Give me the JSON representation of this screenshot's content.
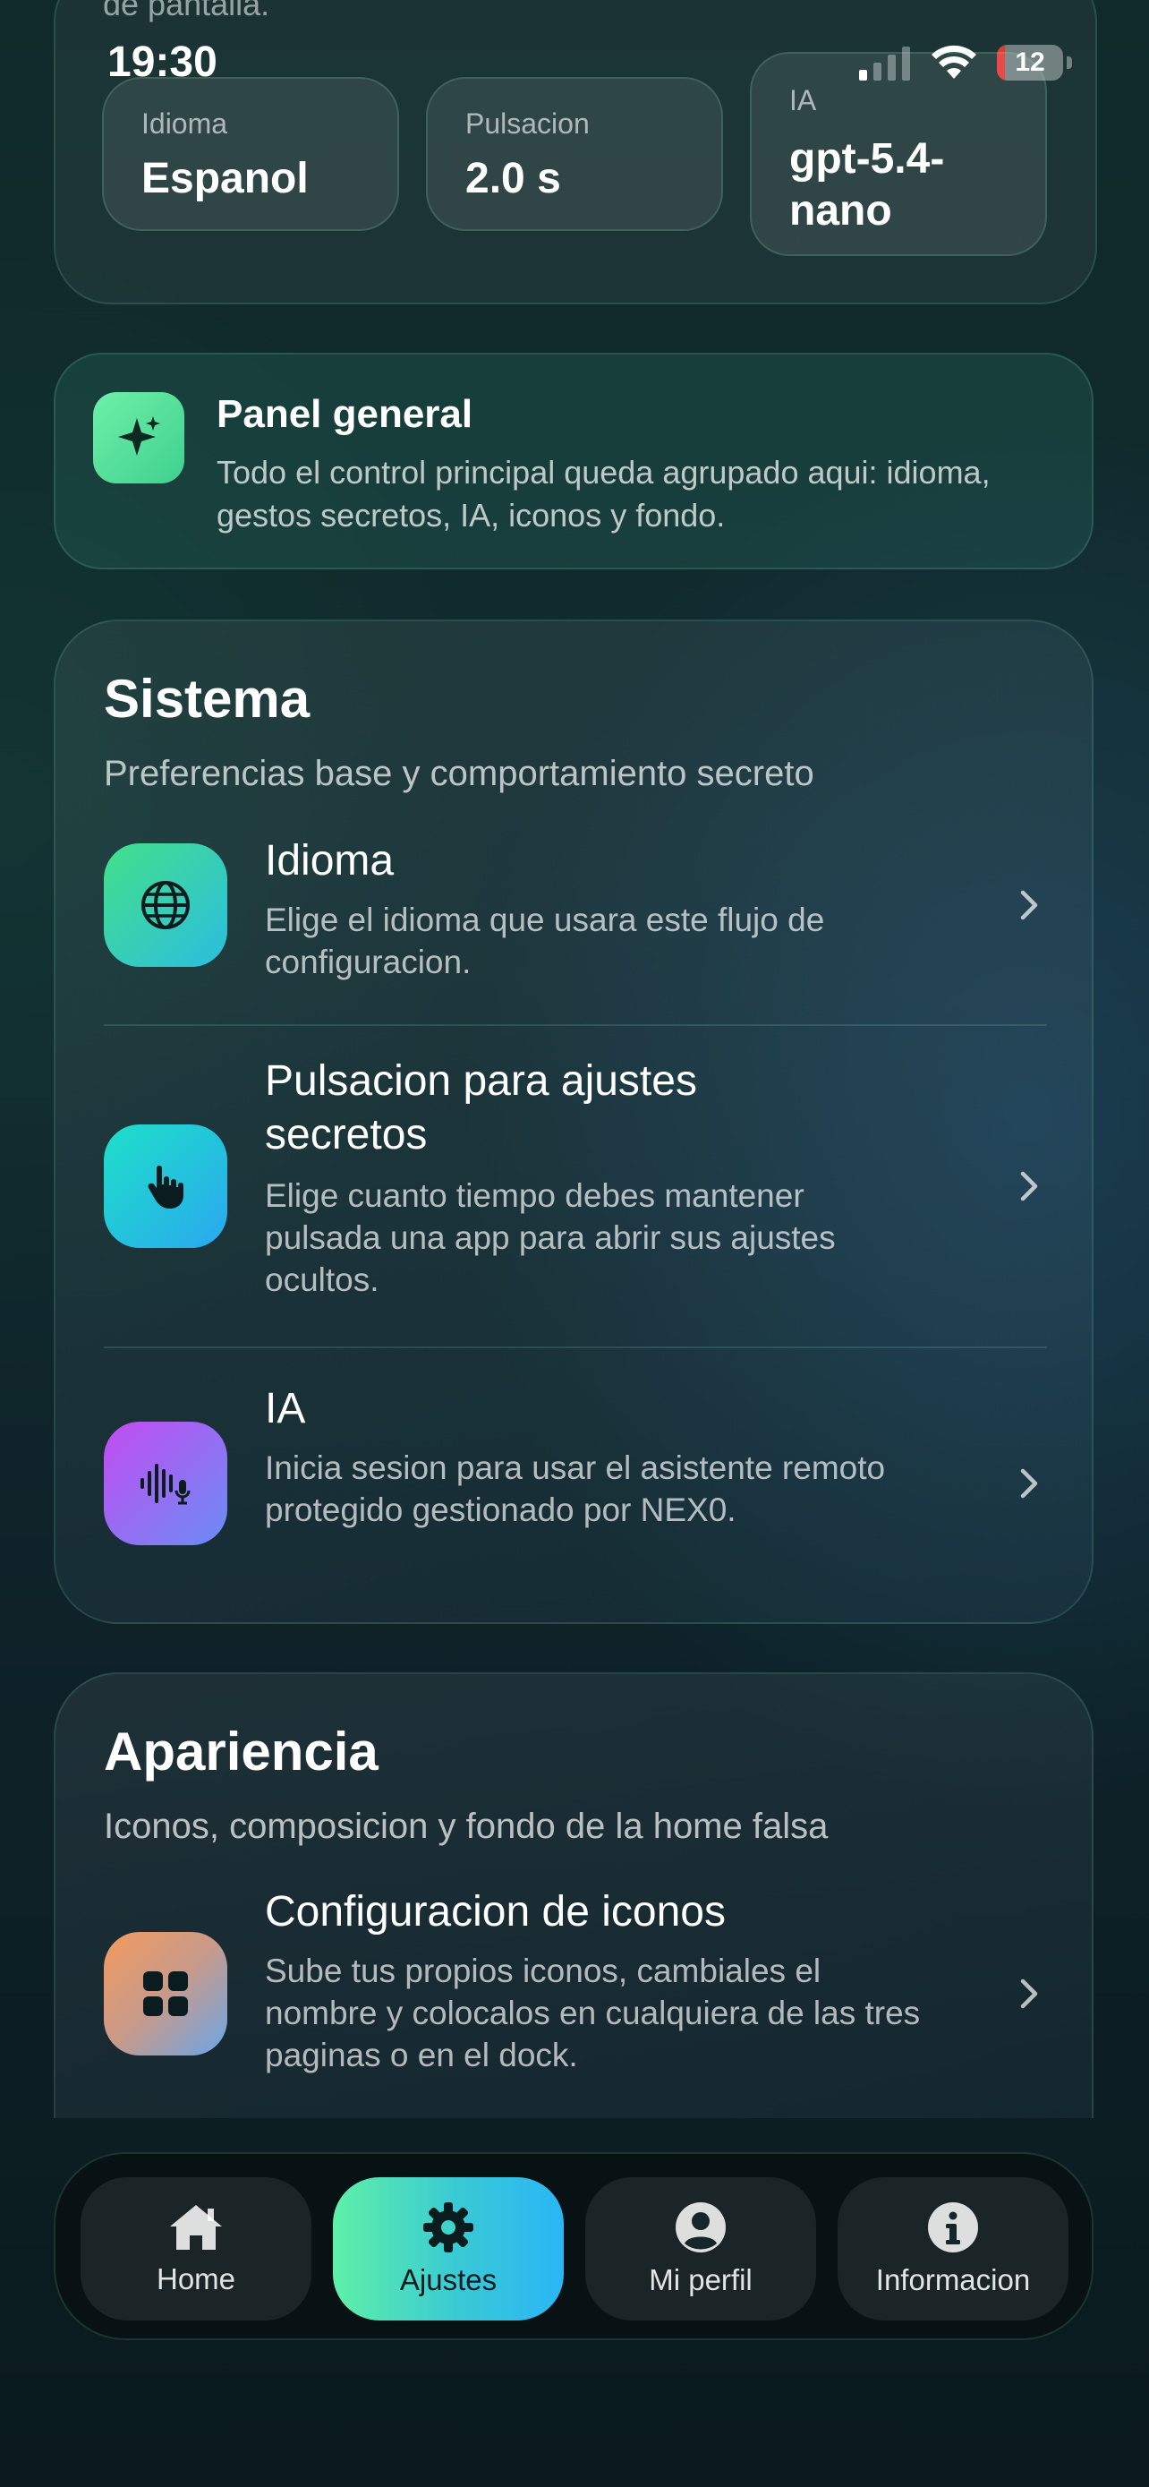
{
  "status_bar": {
    "time": "19:30",
    "battery_level": "12",
    "battery_fraction": 0.12
  },
  "top_card": {
    "subtitle": "de pantalla.",
    "chips": [
      {
        "label": "Idioma",
        "value": "Espanol"
      },
      {
        "label": "Pulsacion",
        "value": "2.0 s"
      },
      {
        "label": "IA",
        "value": "gpt-5.4-nano"
      }
    ]
  },
  "panel_general": {
    "title": "Panel general",
    "description": "Todo el control principal queda agrupado aqui: idioma, gestos secretos, IA, iconos y fondo.",
    "icon": "sparkles-icon"
  },
  "sistema": {
    "title": "Sistema",
    "subtitle": "Preferencias base y comportamiento secreto",
    "items": [
      {
        "title": "Idioma",
        "description": "Elige el idioma que usara este flujo de configuracion.",
        "icon": "globe-icon"
      },
      {
        "title": "Pulsacion para ajustes secretos",
        "description": "Elige cuanto tiempo debes mantener pulsada una app para abrir sus ajustes ocultos.",
        "icon": "hand-tap-icon"
      },
      {
        "title": "IA",
        "description": "Inicia sesion para usar el asistente remoto protegido gestionado por NEX0.",
        "icon": "voice-wave-icon"
      }
    ]
  },
  "apariencia": {
    "title": "Apariencia",
    "subtitle": "Iconos, composicion y fondo de la home falsa",
    "items": [
      {
        "title": "Configuracion de iconos",
        "description": "Sube tus propios iconos, cambiales el nombre y colocalos en cualquiera de las tres paginas o en el dock.",
        "icon": "grid-icon"
      }
    ]
  },
  "bottom_nav": {
    "items": [
      {
        "label": "Home",
        "icon": "house-icon",
        "active": false
      },
      {
        "label": "Ajustes",
        "icon": "gear-icon",
        "active": true
      },
      {
        "label": "Mi perfil",
        "icon": "person-icon",
        "active": false
      },
      {
        "label": "Informacion",
        "icon": "info-icon",
        "active": false
      }
    ]
  },
  "colors": {
    "accent_green": "#5ff0a8",
    "accent_blue": "#2ab6f5",
    "battery_low": "#e53935"
  }
}
